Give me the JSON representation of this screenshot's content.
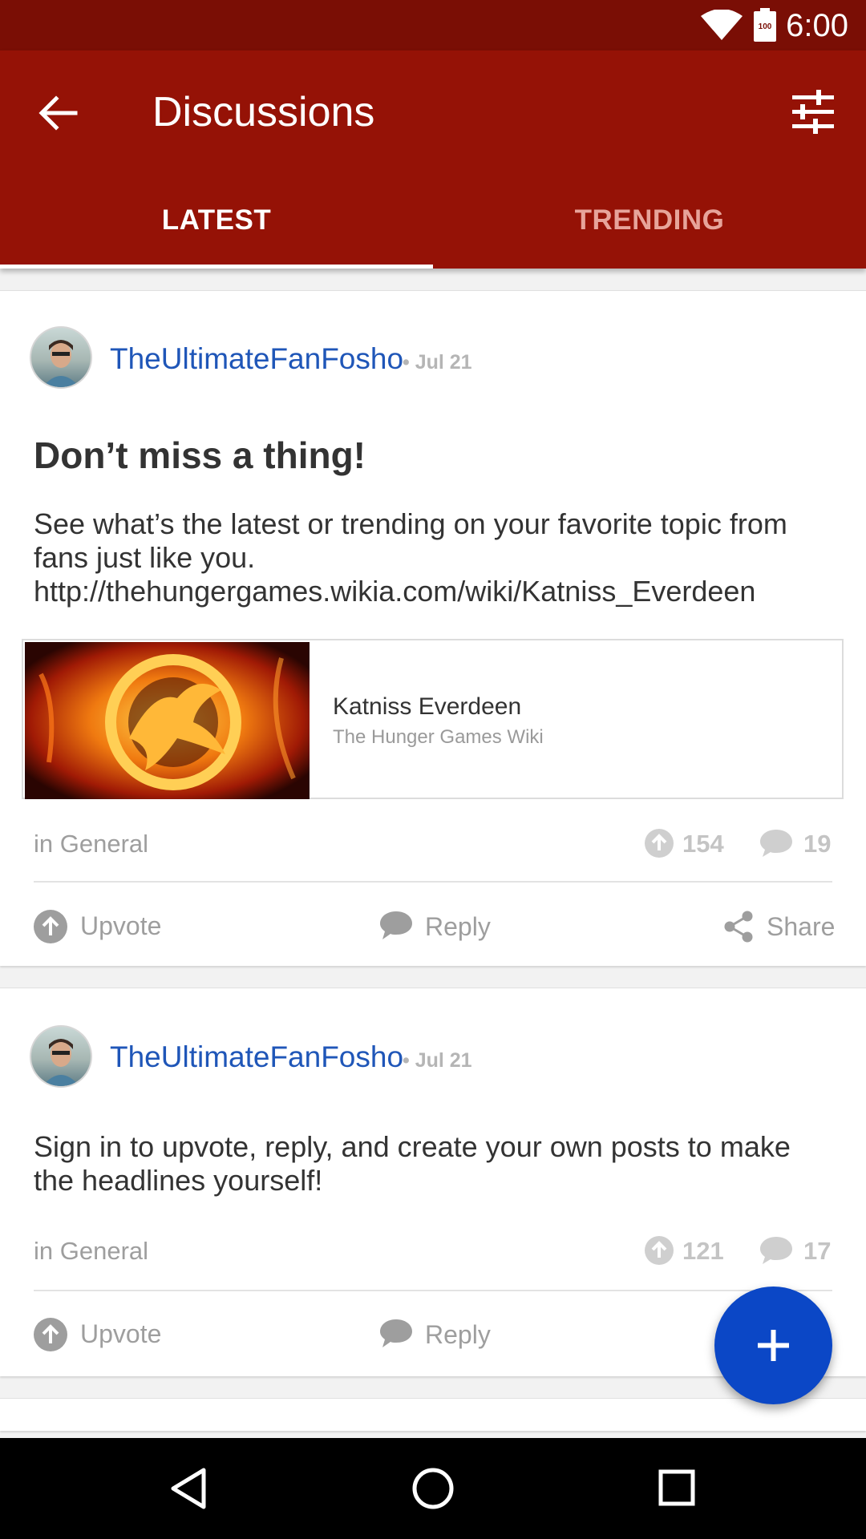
{
  "status_bar": {
    "time": "6:00",
    "battery": "100"
  },
  "app_bar": {
    "title": "Discussions",
    "tabs": [
      {
        "label": "LATEST",
        "selected": true
      },
      {
        "label": "TRENDING",
        "selected": false
      }
    ]
  },
  "posts": [
    {
      "author": "TheUltimateFanFosho",
      "date": "• Jul 21",
      "title": "Don’t miss a thing!",
      "body_lines": [
        "See what’s the latest or trending on your favorite topic from",
        "fans just like you.",
        "http://thehungergames.wikia.com/wiki/Katniss_Everdeen"
      ],
      "link_preview": {
        "title": "Katniss Everdeen",
        "site": "The Hunger Games Wiki"
      },
      "category": "in General",
      "upvotes": "154",
      "replies": "19",
      "actions": {
        "upvote": "Upvote",
        "reply": "Reply",
        "share": "Share"
      }
    },
    {
      "author": "TheUltimateFanFosho",
      "date": "• Jul 21",
      "body_lines": [
        "Sign in to upvote, reply, and create your own posts to make",
        "the headlines yourself!"
      ],
      "category": "in General",
      "upvotes": "121",
      "replies": "17",
      "actions": {
        "upvote": "Upvote",
        "reply": "Reply"
      }
    }
  ],
  "colors": {
    "status_bar": "#7a0e05",
    "app_bar": "#951206",
    "author_link": "#1f56b8",
    "fab": "#0b47c6"
  },
  "icons": {
    "back": "arrow-left-icon",
    "filter": "sliders-icon",
    "upvote": "arrow-up-circle-icon",
    "reply": "speech-bubble-icon",
    "share": "share-icon",
    "fab": "plus-icon"
  }
}
